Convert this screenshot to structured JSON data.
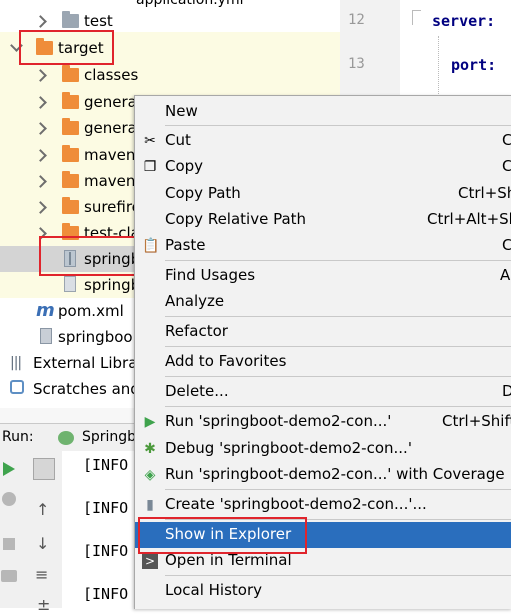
{
  "project_tree": {
    "partial_top_label": "application.yml",
    "items": [
      {
        "label": "test",
        "icon": "folder-grey"
      },
      {
        "label": "target",
        "icon": "folder-orange"
      },
      {
        "label": "classes",
        "icon": "folder-orange"
      },
      {
        "label": "genera",
        "icon": "folder-orange"
      },
      {
        "label": "genera",
        "icon": "folder-orange"
      },
      {
        "label": "maven-",
        "icon": "folder-orange"
      },
      {
        "label": "maven-",
        "icon": "folder-orange"
      },
      {
        "label": "surefire",
        "icon": "folder-orange"
      },
      {
        "label": "test-cla",
        "icon": "folder-orange"
      },
      {
        "label": "springb",
        "icon": "jar-icon"
      },
      {
        "label": "springb",
        "icon": "file-icon"
      },
      {
        "label": "pom.xml",
        "icon": "maven-icon"
      },
      {
        "label": "springboo",
        "icon": "file-icon"
      },
      {
        "label": "External Librar",
        "icon": "library-icon"
      },
      {
        "label": "Scratches and",
        "icon": "scratches-icon"
      }
    ]
  },
  "editor": {
    "lines": [
      {
        "number": "12",
        "code": "server:"
      },
      {
        "number": "13",
        "code": "port:"
      }
    ]
  },
  "run_panel": {
    "label": "Run:",
    "tab": "Springb",
    "console_lines": [
      "[INFO",
      "[INFO",
      "[INFO",
      "[INFO"
    ]
  },
  "context_menu": {
    "items": [
      {
        "label": "New",
        "shortcut": "",
        "icon": ""
      },
      {
        "label": "Cut",
        "shortcut": "C",
        "icon": "scissors-icon"
      },
      {
        "label": "Copy",
        "shortcut": "C",
        "icon": "copy-icon"
      },
      {
        "label": "Copy Path",
        "shortcut": "Ctrl+Sh",
        "icon": ""
      },
      {
        "label": "Copy Relative Path",
        "shortcut": "Ctrl+Alt+Sh",
        "icon": ""
      },
      {
        "label": "Paste",
        "shortcut": "C",
        "icon": "paste-icon"
      },
      {
        "label": "Find Usages",
        "shortcut": "A",
        "icon": ""
      },
      {
        "label": "Analyze",
        "shortcut": "",
        "icon": ""
      },
      {
        "label": "Refactor",
        "shortcut": "",
        "icon": ""
      },
      {
        "label": "Add to Favorites",
        "shortcut": "",
        "icon": ""
      },
      {
        "label": "Delete...",
        "shortcut": "D",
        "icon": ""
      },
      {
        "label": "Run 'springboot-demo2-con...'",
        "shortcut": "Ctrl+Shift",
        "icon": "run-icon"
      },
      {
        "label": "Debug 'springboot-demo2-con...'",
        "shortcut": "",
        "icon": "debug-icon"
      },
      {
        "label": "Run 'springboot-demo2-con...' with Coverage",
        "shortcut": "",
        "icon": "coverage-icon"
      },
      {
        "label": "Create 'springboot-demo2-con...'...",
        "shortcut": "",
        "icon": "jar-icon"
      },
      {
        "label": "Show in Explorer",
        "shortcut": "",
        "icon": ""
      },
      {
        "label": "Open in Terminal",
        "shortcut": "",
        "icon": "terminal-icon"
      },
      {
        "label": "Local History",
        "shortcut": "",
        "icon": ""
      }
    ],
    "highlighted": "Show in Explorer"
  },
  "colors": {
    "highlight": "#2a6ebd",
    "annotation_box": "#e0242c",
    "folder_orange": "#ef8d3a"
  }
}
